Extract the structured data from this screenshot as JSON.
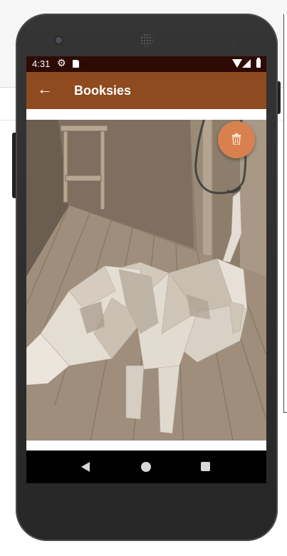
{
  "status_bar": {
    "time": "4:31",
    "icons": [
      "gear-icon",
      "sd-card-icon",
      "wifi-icon",
      "signal-icon",
      "battery-icon"
    ]
  },
  "app_bar": {
    "title": "Booksies",
    "nav_icon": "back-arrow-icon",
    "color": "#8f4a20"
  },
  "content": {
    "image": "low-poly dog in a wooden room",
    "fab_icon": "trash-icon",
    "fab_color": "#d9814e"
  },
  "nav_bar": {
    "buttons": [
      "back",
      "home",
      "recents"
    ]
  },
  "colors": {
    "status_bar": "#2e0a05",
    "app_bar": "#8f4a20",
    "accent": "#d9814e"
  }
}
